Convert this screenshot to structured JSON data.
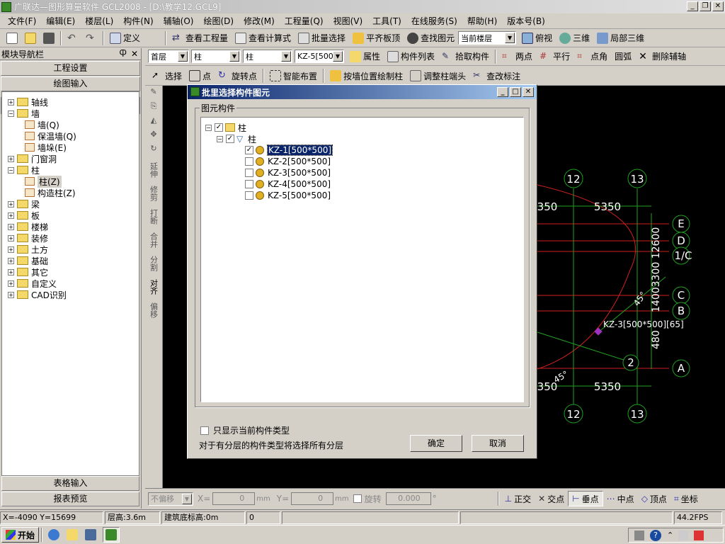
{
  "title": "广联达—图形算量软件 GCL2008 - [D:\\教学12.GCL9]",
  "window_buttons": [
    "_",
    "❐",
    "✕"
  ],
  "menu": [
    "文件(F)",
    "编辑(E)",
    "楼层(L)",
    "构件(N)",
    "辅轴(O)",
    "绘图(D)",
    "修改(M)",
    "工程量(Q)",
    "视图(V)",
    "工具(T)",
    "在线服务(S)",
    "帮助(H)",
    "版本号(B)"
  ],
  "toolbar1": {
    "define": "定义",
    "view_qty": "查看工程量",
    "view_formula": "查看计算式",
    "batch_select": "批量选择",
    "align_slab": "平齐板顶",
    "find_element": "查找图元",
    "floor_combo": "当前楼层",
    "top_view": "俯视",
    "view3d": "三维",
    "local3d": "局部三维"
  },
  "toolbar2": {
    "floor": "首层",
    "cat": "柱",
    "type": "柱",
    "element": "KZ-5[500*",
    "properties": "属性",
    "component_list": "构件列表",
    "pick_component": "拾取构件",
    "two_points": "两点",
    "parallel": "平行",
    "point_angle": "点角",
    "arc": "圆弧",
    "delete_aux": "删除辅轴"
  },
  "toolbar3": {
    "select": "选择",
    "point": "点",
    "rotate_point": "旋转点",
    "smart_layout": "智能布置",
    "wall_draw": "按墙位置绘制柱",
    "adjust_end": "调整柱端头",
    "check_label": "查改标注"
  },
  "nav": {
    "header": "模块导航栏",
    "pin": "Ⴔ",
    "close": "✕",
    "btn_project": "工程设置",
    "btn_draw": "绘图输入",
    "btn_table": "表格输入",
    "btn_report": "报表预览",
    "tree": [
      {
        "level": 0,
        "exp": "+",
        "label": "轴线"
      },
      {
        "level": 0,
        "exp": "−",
        "label": "墙"
      },
      {
        "level": 1,
        "label": "墙(Q)"
      },
      {
        "level": 1,
        "label": "保温墙(Q)"
      },
      {
        "level": 1,
        "label": "墙垛(E)"
      },
      {
        "level": 0,
        "exp": "+",
        "label": "门窗洞"
      },
      {
        "level": 0,
        "exp": "−",
        "label": "柱"
      },
      {
        "level": 1,
        "label": "柱(Z)"
      },
      {
        "level": 1,
        "label": "构造柱(Z)"
      },
      {
        "level": 0,
        "exp": "+",
        "label": "梁"
      },
      {
        "level": 0,
        "exp": "+",
        "label": "板"
      },
      {
        "level": 0,
        "exp": "+",
        "label": "楼梯"
      },
      {
        "level": 0,
        "exp": "+",
        "label": "装修"
      },
      {
        "level": 0,
        "exp": "+",
        "label": "土方"
      },
      {
        "level": 0,
        "exp": "+",
        "label": "基础"
      },
      {
        "level": 0,
        "exp": "+",
        "label": "其它"
      },
      {
        "level": 0,
        "exp": "+",
        "label": "自定义"
      },
      {
        "level": 0,
        "exp": "+",
        "label": "CAD识别"
      }
    ]
  },
  "vtool": [
    "延伸",
    "修剪",
    "打断",
    "合并",
    "分割",
    "对齐",
    "偏移"
  ],
  "dialog": {
    "title": "批里选择构件图元",
    "group": "图元构件",
    "root": "柱",
    "type": "柱",
    "items": [
      {
        "label": "KZ-1[500*500]",
        "checked": true
      },
      {
        "label": "KZ-2[500*500]",
        "checked": false
      },
      {
        "label": "KZ-3[500*500]",
        "checked": false
      },
      {
        "label": "KZ-4[500*500]",
        "checked": false
      },
      {
        "label": "KZ-5[500*500]",
        "checked": false
      }
    ],
    "only_current": "只显示当前构件类型",
    "note": "对于有分层的构件类型将选择所有分层",
    "ok": "确定",
    "cancel": "取消"
  },
  "cad": {
    "axes_top": [
      "12",
      "13"
    ],
    "axes_bottom": [
      "12",
      "13"
    ],
    "dim_top_left": "350",
    "dim_top": "5350",
    "dim_bot_left": "350",
    "dim_bot": "5350",
    "axes_right": [
      "E",
      "D",
      "1/C",
      "C",
      "B",
      "A"
    ],
    "axis_2": "2",
    "column_label": "KZ-3[500*500][65]",
    "angle1": "45°",
    "angle2": "45°",
    "vert_dim": "14003300 12600",
    "vert_dim2": "480"
  },
  "bottom": {
    "offset": "不偏移",
    "x_label": "X=",
    "x_val": "0",
    "unit": "mm",
    "y_label": "Y=",
    "y_val": "0",
    "rotate": "旋转",
    "rot_val": "0.000",
    "deg": "°",
    "ortho": "正交",
    "intersect": "交点",
    "perp": "垂点",
    "mid": "中点",
    "vertex": "顶点",
    "coord": "坐标"
  },
  "status": {
    "coords": "X=-4090 Y=15699",
    "floor_height": "层高:3.6m",
    "base_elev": "建筑底标高:0m",
    "zero": "0",
    "fps": "44.2FPS"
  },
  "taskbar": {
    "start": "开始"
  }
}
